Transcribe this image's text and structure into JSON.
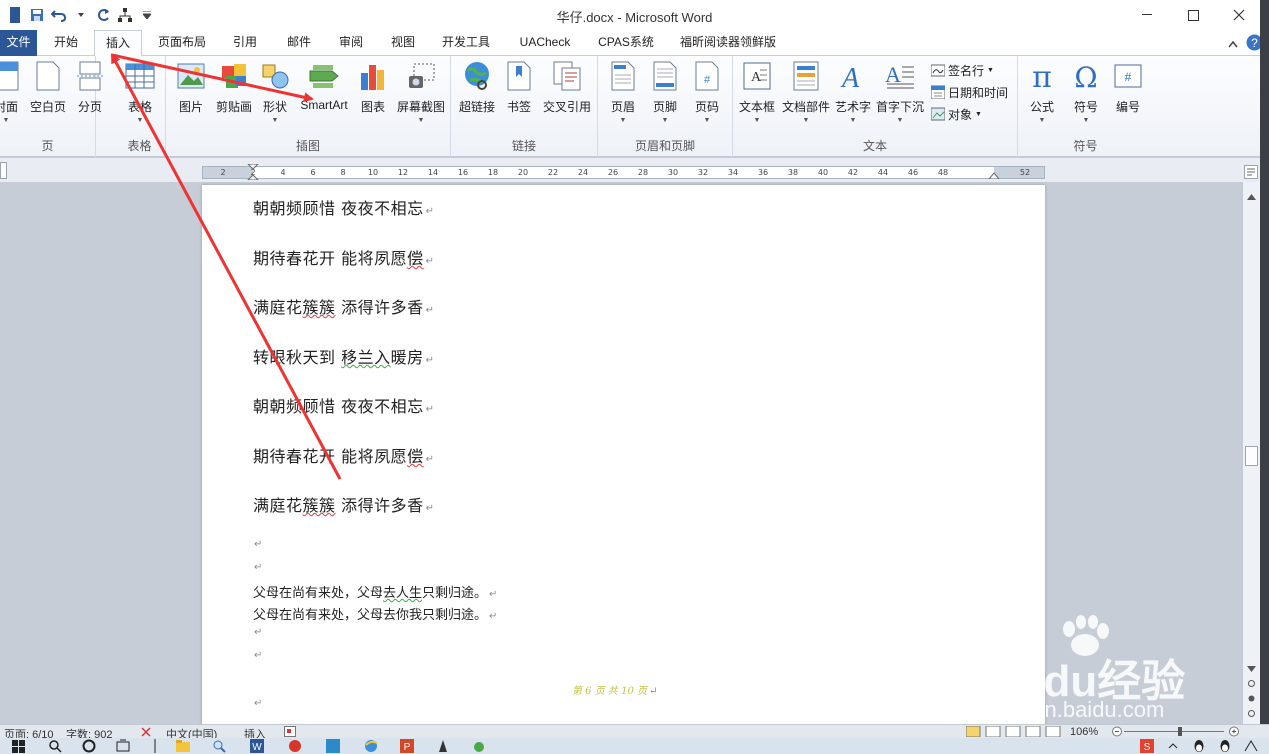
{
  "window": {
    "title": "华仔.docx - Microsoft Word"
  },
  "tabs": [
    "文件",
    "开始",
    "插入",
    "页面布局",
    "引用",
    "邮件",
    "审阅",
    "视图",
    "开发工具",
    "UACheck",
    "CPAS系统",
    "福昕阅读器领鲜版"
  ],
  "active_tab": "插入",
  "ribbon": {
    "pages": {
      "label": "页",
      "cover": "封面",
      "blank": "空白页",
      "break": "分页"
    },
    "tables": {
      "label": "表格",
      "table": "表格"
    },
    "illustrations": {
      "label": "插图",
      "picture": "图片",
      "clipart": "剪贴画",
      "shapes": "形状",
      "smartart": "SmartArt",
      "chart": "图表",
      "screenshot": "屏幕截图"
    },
    "links": {
      "label": "链接",
      "hyperlink": "超链接",
      "bookmark": "书签",
      "crossref": "交叉引用"
    },
    "header_footer": {
      "label": "页眉和页脚",
      "header": "页眉",
      "footer": "页脚",
      "page_number": "页码"
    },
    "text": {
      "label": "文本",
      "textbox": "文本框",
      "quickparts": "文档部件",
      "wordart": "艺术字",
      "dropcap": "首字下沉",
      "signature": "签名行",
      "datetime": "日期和时间",
      "object": "对象"
    },
    "symbols": {
      "label": "符号",
      "equation": "公式",
      "symbol": "符号",
      "number": "编号"
    }
  },
  "ruler_ticks": [
    "2",
    "2",
    "4",
    "6",
    "8",
    "10",
    "12",
    "14",
    "16",
    "18",
    "20",
    "22",
    "24",
    "26",
    "28",
    "30",
    "32",
    "34",
    "36",
    "38",
    "40",
    "42",
    "44",
    "46",
    "48",
    "52"
  ],
  "document": {
    "poem_lines": [
      {
        "a": "朝朝",
        "b": "频顾",
        "c": "惜 夜夜不相忘",
        "squiggle": ""
      },
      {
        "a": "期待春花开 能将夙愿",
        "b": "偿",
        "c": "",
        "squiggle": "red"
      },
      {
        "a": "满庭花",
        "b": "簇簇",
        "c": " 添得许多香",
        "squiggle": "red"
      },
      {
        "a": "转眼秋天到 ",
        "b": "移兰入",
        "c": "暖房",
        "squiggle": "green"
      },
      {
        "a": "朝朝",
        "b": "频顾",
        "c": "惜 夜夜不相忘",
        "squiggle": ""
      },
      {
        "a": "期待春花开 能将夙愿",
        "b": "偿",
        "c": "",
        "squiggle": "red"
      },
      {
        "a": "满庭花",
        "b": "簇簇",
        "c": " 添得许多香",
        "squiggle": "red"
      }
    ],
    "prose_1": {
      "a": "父母在尚有来处，父母",
      "b": "去人生",
      "c": "只剩归途。"
    },
    "prose_2": "父母在尚有来处，父母去你我只剩归途。",
    "footer": "第 6 页  共 10 页"
  },
  "statusbar": {
    "page": "页面: 6/10",
    "words": "字数: 902",
    "language": "中文(中国)",
    "mode": "插入",
    "zoom": "106%"
  },
  "watermark": {
    "brand": "Baidu经验",
    "url": "jingyan.baidu.com"
  },
  "colors": {
    "file_tab": "#2b5797",
    "annotation": "#ee3333"
  }
}
